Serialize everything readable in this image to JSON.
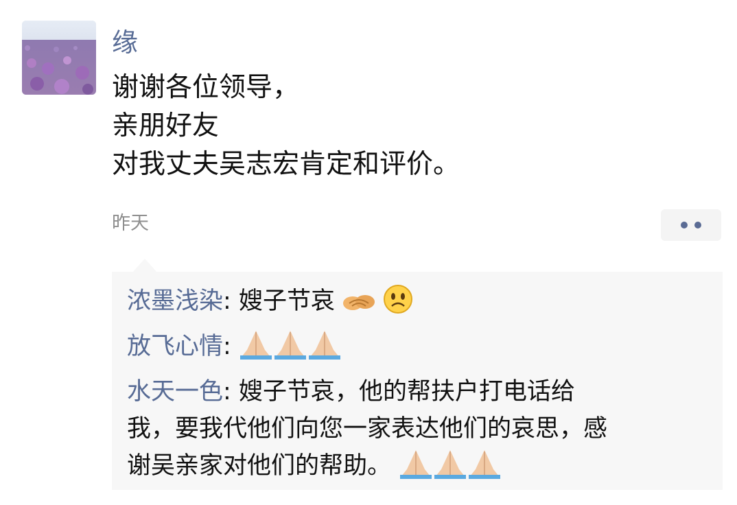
{
  "post": {
    "author": "缘",
    "lines": [
      "谢谢各位领导，",
      "亲朋好友",
      "对我丈夫吴志宏肯定和评价。"
    ],
    "time": "昨天",
    "more_icon": "more-dots-icon"
  },
  "comments": [
    {
      "name": "浓墨浅染",
      "separator": ": ",
      "text": "嫂子节哀",
      "emojis": [
        "handshake-emoji",
        "sad-face-emoji"
      ]
    },
    {
      "name": "放飞心情",
      "separator": ": ",
      "text": "",
      "emojis": [
        "folded-hands-emoji",
        "folded-hands-emoji",
        "folded-hands-emoji"
      ]
    },
    {
      "name": "水天一色",
      "separator": ": ",
      "lines": [
        "嫂子节哀，他的帮扶户打电话给",
        "我，要我代他们向您一家表达他们的哀思，感",
        "谢吴亲家对他们的帮助。"
      ],
      "emojis": [
        "folded-hands-emoji",
        "folded-hands-emoji",
        "folded-hands-emoji"
      ]
    }
  ],
  "colors": {
    "name_blue": "#576b95",
    "text": "#111111",
    "meta_gray": "#8f8f8f",
    "comment_bg": "#f7f7f7"
  }
}
